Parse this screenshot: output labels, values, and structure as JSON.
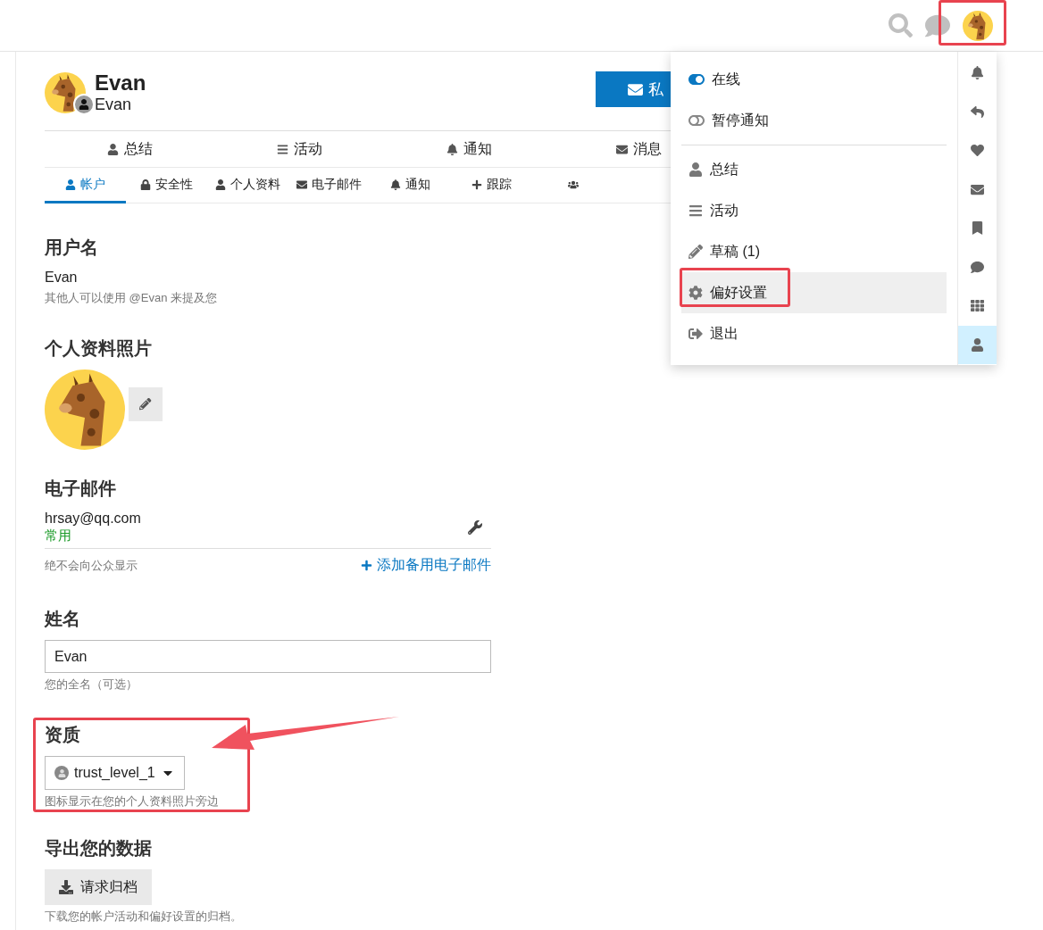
{
  "profile": {
    "name": "Evan",
    "username": "Evan",
    "message_button": "私"
  },
  "primary_nav": [
    {
      "label": "总结"
    },
    {
      "label": "活动"
    },
    {
      "label": "通知"
    },
    {
      "label": "消息"
    }
  ],
  "secondary_tabs": [
    {
      "label": "帐户",
      "selected": true
    },
    {
      "label": "安全性",
      "selected": false
    },
    {
      "label": "个人资料",
      "selected": false
    },
    {
      "label": "电子邮件",
      "selected": false
    },
    {
      "label": "通知",
      "selected": false
    },
    {
      "label": "跟踪",
      "selected": false
    },
    {
      "selected": false
    }
  ],
  "username": {
    "heading": "用户名",
    "value": "Evan",
    "hint": "其他人可以使用 @Evan 来提及您"
  },
  "photo": {
    "heading": "个人资料照片"
  },
  "email": {
    "heading": "电子邮件",
    "address": "hrsay@qq.com",
    "tag": "常用",
    "hint": "绝不会向公众显示",
    "add_link": "添加备用电子邮件"
  },
  "name": {
    "heading": "姓名",
    "value": "Evan",
    "hint": "您的全名（可选）"
  },
  "title": {
    "heading": "资质",
    "value": "trust_level_1",
    "hint": "图标显示在您的个人资料照片旁边"
  },
  "export": {
    "heading": "导出您的数据",
    "button": "请求归档",
    "hint": "下载您的帐户活动和偏好设置的归档。"
  },
  "user_menu": {
    "status": [
      {
        "label": "在线",
        "on": true
      },
      {
        "label": "暂停通知",
        "on": false
      }
    ],
    "items": [
      {
        "label": "总结",
        "selected": false
      },
      {
        "label": "活动",
        "selected": false
      },
      {
        "label": "草稿 (1)",
        "selected": false
      },
      {
        "label": "偏好设置",
        "selected": true
      },
      {
        "label": "退出",
        "selected": false
      }
    ],
    "tabs": [
      {
        "selected": false
      },
      {
        "selected": false
      },
      {
        "selected": false
      },
      {
        "selected": false
      },
      {
        "selected": false
      },
      {
        "selected": false
      },
      {
        "selected": false
      },
      {
        "selected": true
      }
    ]
  }
}
